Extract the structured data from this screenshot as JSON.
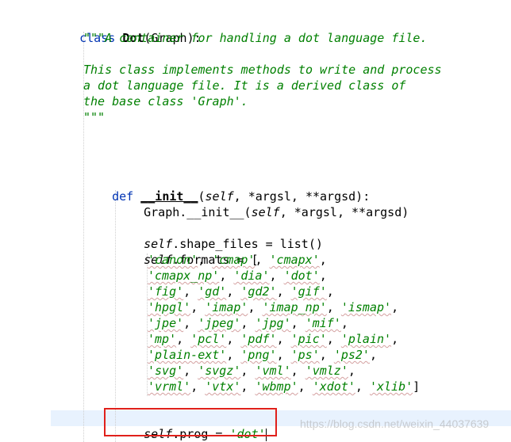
{
  "code": {
    "class_keyword": "class",
    "class_name": "Dot",
    "class_base": "(Graph):",
    "doc_line1": "\"\"\"A container for handling a dot language file.",
    "doc_line2": "This class implements methods to write and process",
    "doc_line3": "a dot language file. It is a derived class of",
    "doc_line4": "the base class 'Graph'.",
    "doc_line5": "\"\"\"",
    "def_keyword": "def",
    "init_name": "__init__",
    "init_open": "(",
    "init_self": "self",
    "init_params": ", *argsl, **argsd):",
    "graph_call_prefix": "Graph.__init__(",
    "graph_call_self": "self",
    "graph_call_rest": ", *argsl, **argsd)",
    "shape_self": "self",
    "shape_rest": ".shape_files = list()",
    "formats_self": "self",
    "formats_rest": ".formats = [",
    "prog_self": "self",
    "prog_assign": ".prog = ",
    "prog_value": "'dot'"
  },
  "formats_rows": [
    [
      "'canon'",
      "'cmap'",
      "'cmapx'"
    ],
    [
      "'cmapx_np'",
      "'dia'",
      "'dot'"
    ],
    [
      "'fig'",
      "'gd'",
      "'gd2'",
      "'gif'"
    ],
    [
      "'hpgl'",
      "'imap'",
      "'imap_np'",
      "'ismap'"
    ],
    [
      "'jpe'",
      "'jpeg'",
      "'jpg'",
      "'mif'"
    ],
    [
      "'mp'",
      "'pcl'",
      "'pdf'",
      "'pic'",
      "'plain'"
    ],
    [
      "'plain-ext'",
      "'png'",
      "'ps'",
      "'ps2'"
    ],
    [
      "'svg'",
      "'svgz'",
      "'vml'",
      "'vmlz'"
    ],
    [
      "'vrml'",
      "'vtx'",
      "'wbmp'",
      "'xdot'",
      "'xlib'"
    ]
  ],
  "formats_close": "]",
  "watermark": "https://blog.csdn.net/weixin_44037639",
  "colors": {
    "keyword": "#0033b3",
    "string": "#008000",
    "highlight_box": "#e0201b",
    "current_line": "#e8f2fe"
  }
}
